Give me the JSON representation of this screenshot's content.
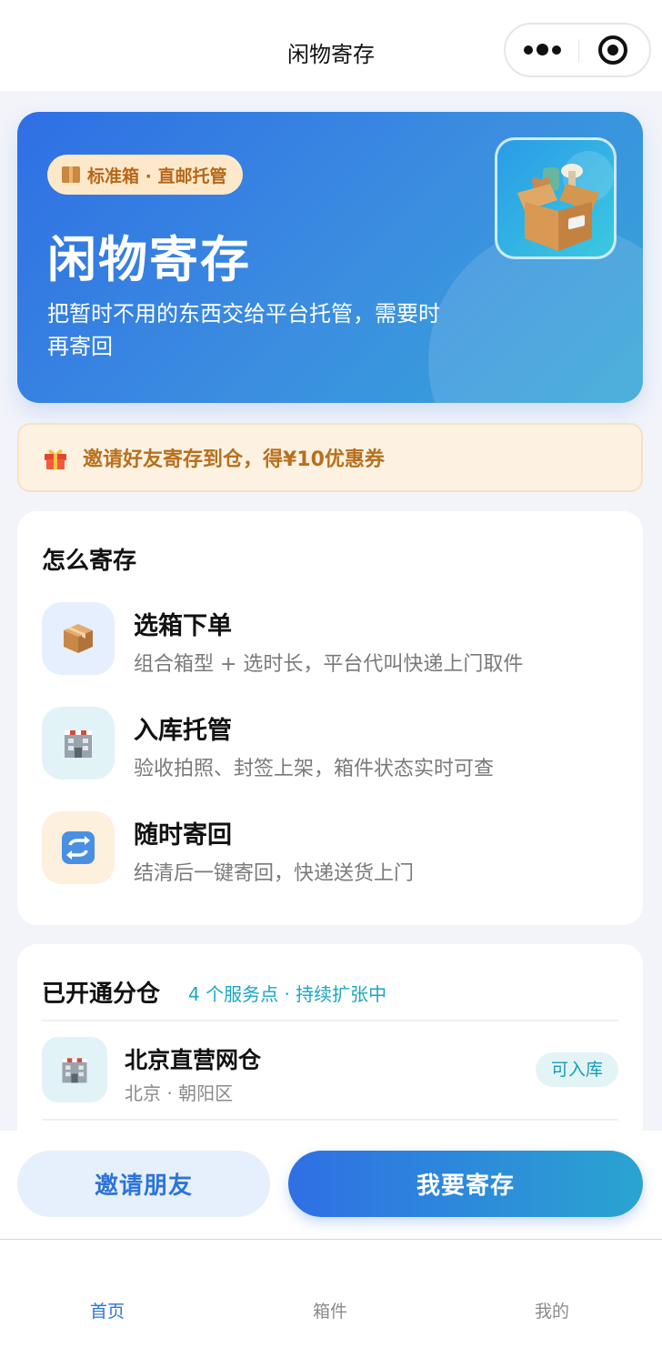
{
  "nav": {
    "title": "闲物寄存"
  },
  "hero": {
    "badge": "标准箱 · 直邮托管",
    "title": "闲物寄存",
    "desc_line1": "把暂时不用的东西交给平台托管，需要时",
    "desc_line2": "再寄回"
  },
  "promo": {
    "text": "邀请好友寄存到仓，得¥10优惠券"
  },
  "how": {
    "title": "怎么寄存",
    "steps": [
      {
        "title": "选箱下单",
        "desc": "组合箱型 + 选时长，平台代叫快递上门取件",
        "icon": "package-icon"
      },
      {
        "title": "入库托管",
        "desc": "验收拍照、封签上架，箱件状态实时可查",
        "icon": "warehouse-icon"
      },
      {
        "title": "随时寄回",
        "desc": "结清后一键寄回，快递送货上门",
        "icon": "repeat-icon"
      }
    ]
  },
  "warehouses": {
    "title": "已开通分仓",
    "subtitle": "4 个服务点 · 持续扩张中",
    "items": [
      {
        "name": "北京直营网仓",
        "location": "北京 · 朝阳区",
        "tag": "可入库"
      }
    ]
  },
  "actions": {
    "invite": "邀请朋友",
    "store": "我要寄存"
  },
  "tabs": [
    {
      "label": "首页",
      "active": true
    },
    {
      "label": "箱件",
      "active": false
    },
    {
      "label": "我的",
      "active": false
    }
  ],
  "colors": {
    "primary": "#2f6fe4",
    "accent_cyan": "#19a6c2",
    "promo_text": "#b8701e"
  }
}
